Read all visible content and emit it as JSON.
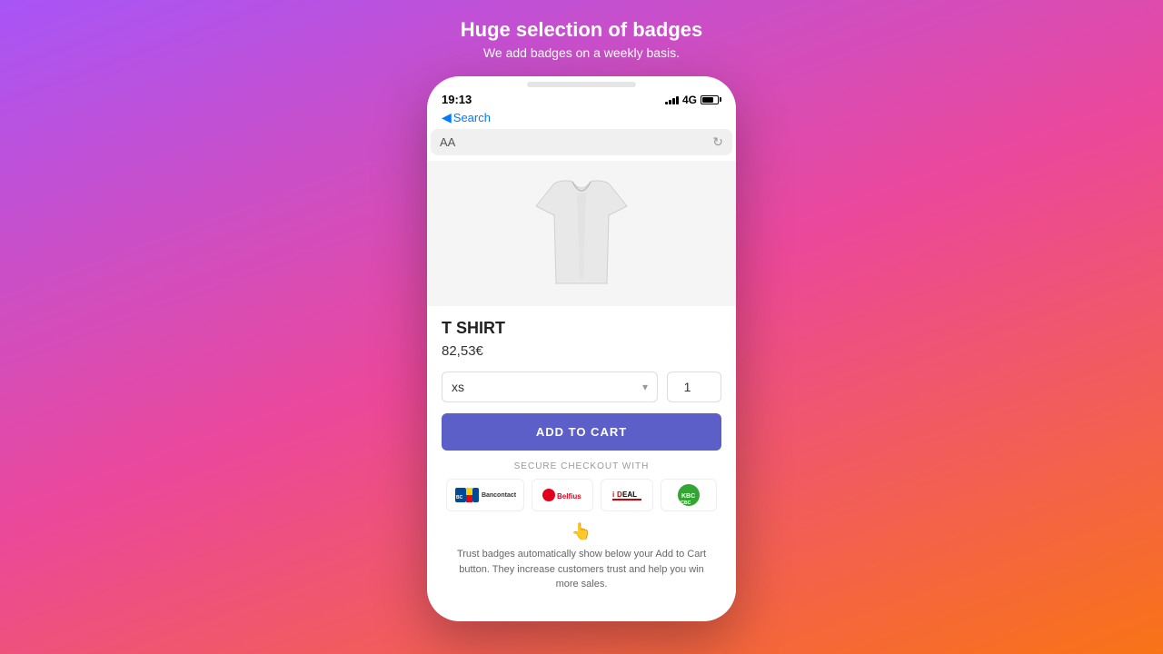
{
  "headline": {
    "title": "Huge selection of badges",
    "subtitle": "We add badges on a weekly basis."
  },
  "phone": {
    "status_bar": {
      "time": "19:13",
      "network": "4G"
    },
    "nav": {
      "back_label": "Search"
    },
    "address_bar": {
      "text": "AA"
    }
  },
  "product": {
    "name": "T SHIRT",
    "price": "82,53€",
    "size_default": "xs",
    "quantity_default": "1",
    "add_to_cart_label": "ADD TO CART",
    "secure_checkout_label": "SECURE CHECKOUT WITH",
    "payment_methods": [
      {
        "name": "Bancontact",
        "label": "Bancontact"
      },
      {
        "name": "Belfius",
        "label": "Belfius"
      },
      {
        "name": "iDEAL",
        "label": "iDEAL"
      },
      {
        "name": "KBC/CBC",
        "label": "KBC/CBC"
      }
    ],
    "trust_emoji": "👆",
    "trust_text": "Trust badges automatically show below your Add to Cart button. They increase customers trust and help you win more sales."
  }
}
